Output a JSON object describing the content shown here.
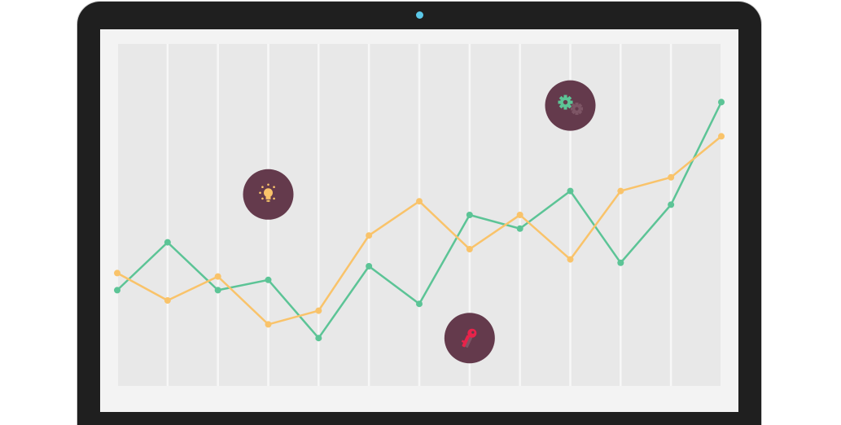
{
  "colors": {
    "frame": "#1f1f1f",
    "screen": "#f3f3f3",
    "plot_area": "#e8e8e8",
    "gridline": "#f7f7f7",
    "webcam": "#5bc8e8",
    "series_green": "#5cc496",
    "series_orange": "#f9c36a",
    "badge": "#643a4c"
  },
  "chart_data": {
    "type": "line",
    "title": "",
    "xlabel": "",
    "ylabel": "",
    "grid": "vertical",
    "legend": "none",
    "x": [
      0,
      1,
      2,
      3,
      4,
      5,
      6,
      7,
      8,
      9,
      10,
      11,
      12
    ],
    "xlim": [
      0,
      12
    ],
    "ylim": [
      0,
      100
    ],
    "series": [
      {
        "color": "#5cc496",
        "values": [
          28,
          42,
          28,
          31,
          14,
          35,
          24,
          50,
          46,
          57,
          36,
          53,
          83
        ]
      },
      {
        "color": "#f9c36a",
        "values": [
          33,
          25,
          32,
          18,
          22,
          44,
          54,
          40,
          50,
          37,
          57,
          61,
          73
        ]
      }
    ],
    "badges": [
      {
        "icon": "lightbulb-icon",
        "x": 3,
        "y": 56
      },
      {
        "icon": "gears-icon",
        "x": 9,
        "y": 82
      },
      {
        "icon": "key-icon",
        "x": 7,
        "y": 14
      }
    ]
  }
}
